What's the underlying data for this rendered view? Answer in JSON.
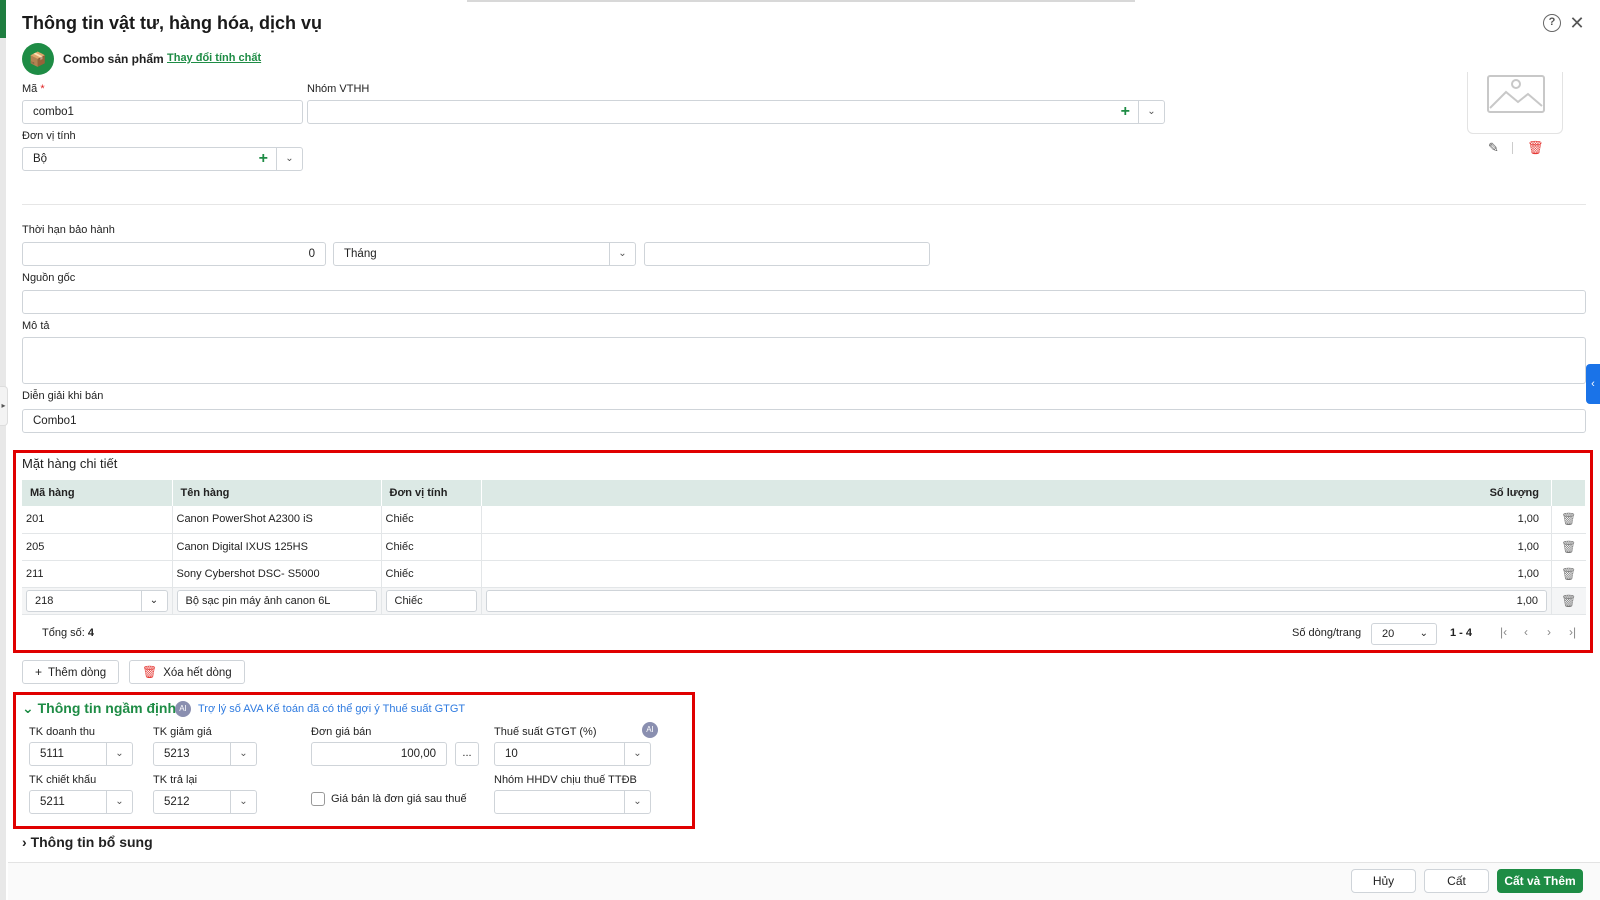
{
  "header": {
    "title": "Thông tin vật tư, hàng hóa, dịch vụ",
    "help_icon": "question-circle-icon",
    "close_icon": "close-icon"
  },
  "kind": {
    "label": "Combo sản phẩm",
    "change_link": "Thay đổi tính chất"
  },
  "form": {
    "code_label": "Mã",
    "code_required": "*",
    "code_value": "combo1",
    "group_label": "Nhóm VTHH",
    "group_value": "",
    "unit_label": "Đơn vị tính",
    "unit_value": "Bộ",
    "warranty_label": "Thời hạn bảo hành",
    "warranty_value": "0",
    "warranty_unit": "Tháng",
    "warranty_extra": "",
    "origin_label": "Nguồn gốc",
    "origin_value": "",
    "desc_label": "Mô tả",
    "desc_value": "",
    "sale_desc_label": "Diễn giải khi bán",
    "sale_desc_value": "Combo1"
  },
  "detail": {
    "title": "Mặt hàng chi tiết",
    "columns": [
      "Mã hàng",
      "Tên hàng",
      "Đơn vị tính",
      "Số lượng"
    ],
    "rows": [
      {
        "code": "201",
        "name": "Canon PowerShot A2300 iS",
        "unit": "Chiếc",
        "qty": "1,00"
      },
      {
        "code": "205",
        "name": "Canon Digital IXUS 125HS",
        "unit": "Chiếc",
        "qty": "1,00"
      },
      {
        "code": "211",
        "name": "Sony Cybershot DSC- S5000",
        "unit": "Chiếc",
        "qty": "1,00"
      },
      {
        "code": "218",
        "name": "Bộ sạc pin máy ảnh canon 6L",
        "unit": "Chiếc",
        "qty": "1,00"
      }
    ],
    "total_label": "Tổng số:",
    "total_value": "4",
    "rows_per_page_label": "Số dòng/trang",
    "rows_per_page": "20",
    "range": "1 - 4",
    "add_row": "Thêm dòng",
    "clear_rows": "Xóa hết dòng"
  },
  "defaults": {
    "title": "Thông tin ngầm định",
    "ava_hint": "Trợ lý số AVA Kế toán đã có thể gợi ý Thuế suất GTGT",
    "revenue_label": "TK doanh thu",
    "revenue_value": "5111",
    "discount_label": "TK giảm giá",
    "discount_value": "5213",
    "price_label": "Đơn giá bán",
    "price_value": "100,00",
    "price_more": "...",
    "vat_label": "Thuế suất GTGT (%)",
    "vat_value": "10",
    "rebate_label": "TK chiết khấu",
    "rebate_value": "5211",
    "return_label": "TK trả lại",
    "return_value": "5212",
    "after_tax_label": "Giá bán là đơn giá sau thuế",
    "excise_label": "Nhóm HHDV chịu thuế TTĐB",
    "excise_value": ""
  },
  "extra": {
    "title": "Thông tin bổ sung"
  },
  "footer": {
    "cancel": "Hủy",
    "save": "Cất",
    "save_add": "Cất và Thêm"
  },
  "colors": {
    "brand_green": "#1e8c45",
    "highlight_red": "#e00000",
    "header_row": "#dce9e5",
    "ava_blue": "#2f7be0"
  }
}
